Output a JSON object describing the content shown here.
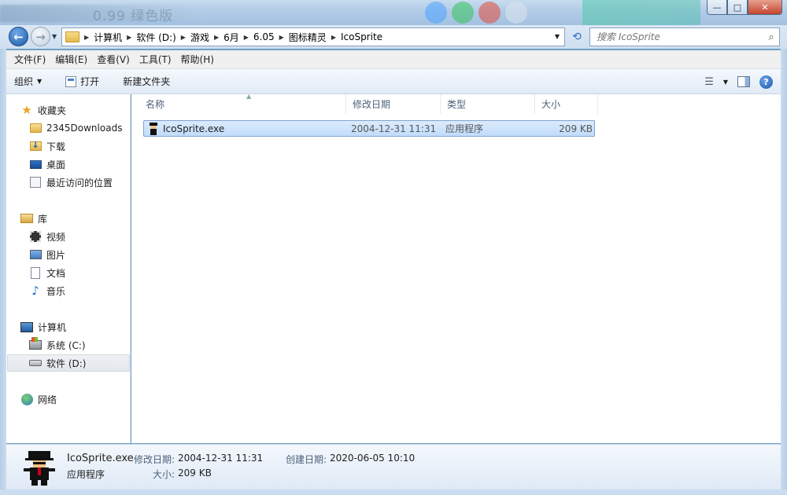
{
  "titlebar": {
    "ghost_text": "0.99 绿色版",
    "buttons": {
      "minimize": "—",
      "maximize": "□",
      "close": "✕"
    }
  },
  "address": {
    "breadcrumbs": [
      "计算机",
      "软件 (D:)",
      "游戏",
      "6月",
      "6.05",
      "图标精灵",
      "IcoSprite"
    ],
    "search_placeholder": "搜索 IcoSprite"
  },
  "menu": [
    "文件(F)",
    "编辑(E)",
    "查看(V)",
    "工具(T)",
    "帮助(H)"
  ],
  "toolbar": {
    "organize": "组织",
    "open": "打开",
    "new_folder": "新建文件夹"
  },
  "navpane": {
    "favorites": {
      "label": "收藏夹",
      "items": [
        "2345Downloads",
        "下载",
        "桌面",
        "最近访问的位置"
      ]
    },
    "libraries": {
      "label": "库",
      "items": [
        "视频",
        "图片",
        "文档",
        "音乐"
      ]
    },
    "computer": {
      "label": "计算机",
      "items": [
        "系统 (C:)",
        "软件 (D:)"
      ],
      "selected": "软件 (D:)"
    },
    "network": {
      "label": "网络"
    }
  },
  "columns": [
    "名称",
    "修改日期",
    "类型",
    "大小"
  ],
  "files": [
    {
      "name": "IcoSprite.exe",
      "modified": "2004-12-31 11:31",
      "type": "应用程序",
      "size": "209 KB"
    }
  ],
  "details": {
    "filename": "IcoSprite.exe",
    "type": "应用程序",
    "modified_label": "修改日期:",
    "modified": "2004-12-31 11:31",
    "created_label": "创建日期:",
    "created": "2020-06-05 10:10",
    "size_label": "大小:",
    "size": "209 KB"
  },
  "colors": {
    "accent": "#1e5aa8",
    "selection": "#c1dcfb",
    "frame": "#b5cde6"
  }
}
